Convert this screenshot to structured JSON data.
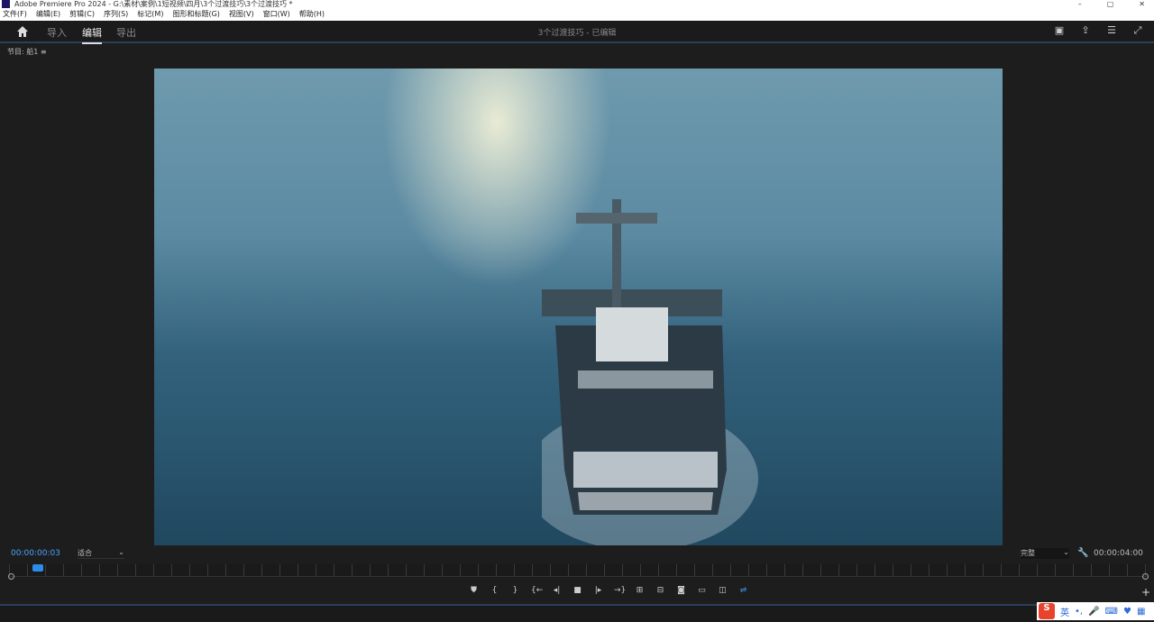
{
  "window": {
    "title": "Adobe Premiere Pro 2024 - G:\\素材\\案例\\1短视频\\四月\\3个过渡技巧\\3个过渡技巧 *",
    "min": "–",
    "max": "▢",
    "close": "✕"
  },
  "menu": [
    "文件(F)",
    "编辑(E)",
    "剪辑(C)",
    "序列(S)",
    "标记(M)",
    "图形和标题(G)",
    "视图(V)",
    "窗口(W)",
    "帮助(H)"
  ],
  "header": {
    "tabs": [
      "导入",
      "编辑",
      "导出"
    ],
    "active_tab": "编辑",
    "project_title": "3个过渡技巧 - 已编辑"
  },
  "program": {
    "label": "节目: 船1",
    "menu_icon": "≡",
    "timecode_current": "00:00:00:03",
    "timecode_duration": "00:00:04:00",
    "fit": "适合",
    "quality": "完整",
    "accent": "#4aa3ff"
  },
  "transport": [
    "marker",
    "mark-in",
    "mark-out",
    "go-to-in",
    "step-back",
    "stop",
    "step-forward",
    "go-to-out",
    "insert",
    "overwrite",
    "export-frame",
    "comparison-view",
    "proxy",
    "multi-camera"
  ],
  "ime": {
    "logo": "S",
    "lang": "英"
  }
}
